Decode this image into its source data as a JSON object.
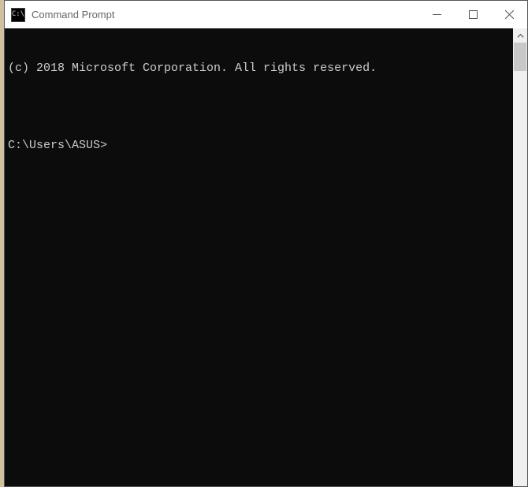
{
  "window": {
    "title": "Command Prompt",
    "icon_label": "C:\\"
  },
  "terminal": {
    "copyright": "(c) 2018 Microsoft Corporation. All rights reserved.",
    "blank": "",
    "prompt": "C:\\Users\\ASUS>"
  }
}
